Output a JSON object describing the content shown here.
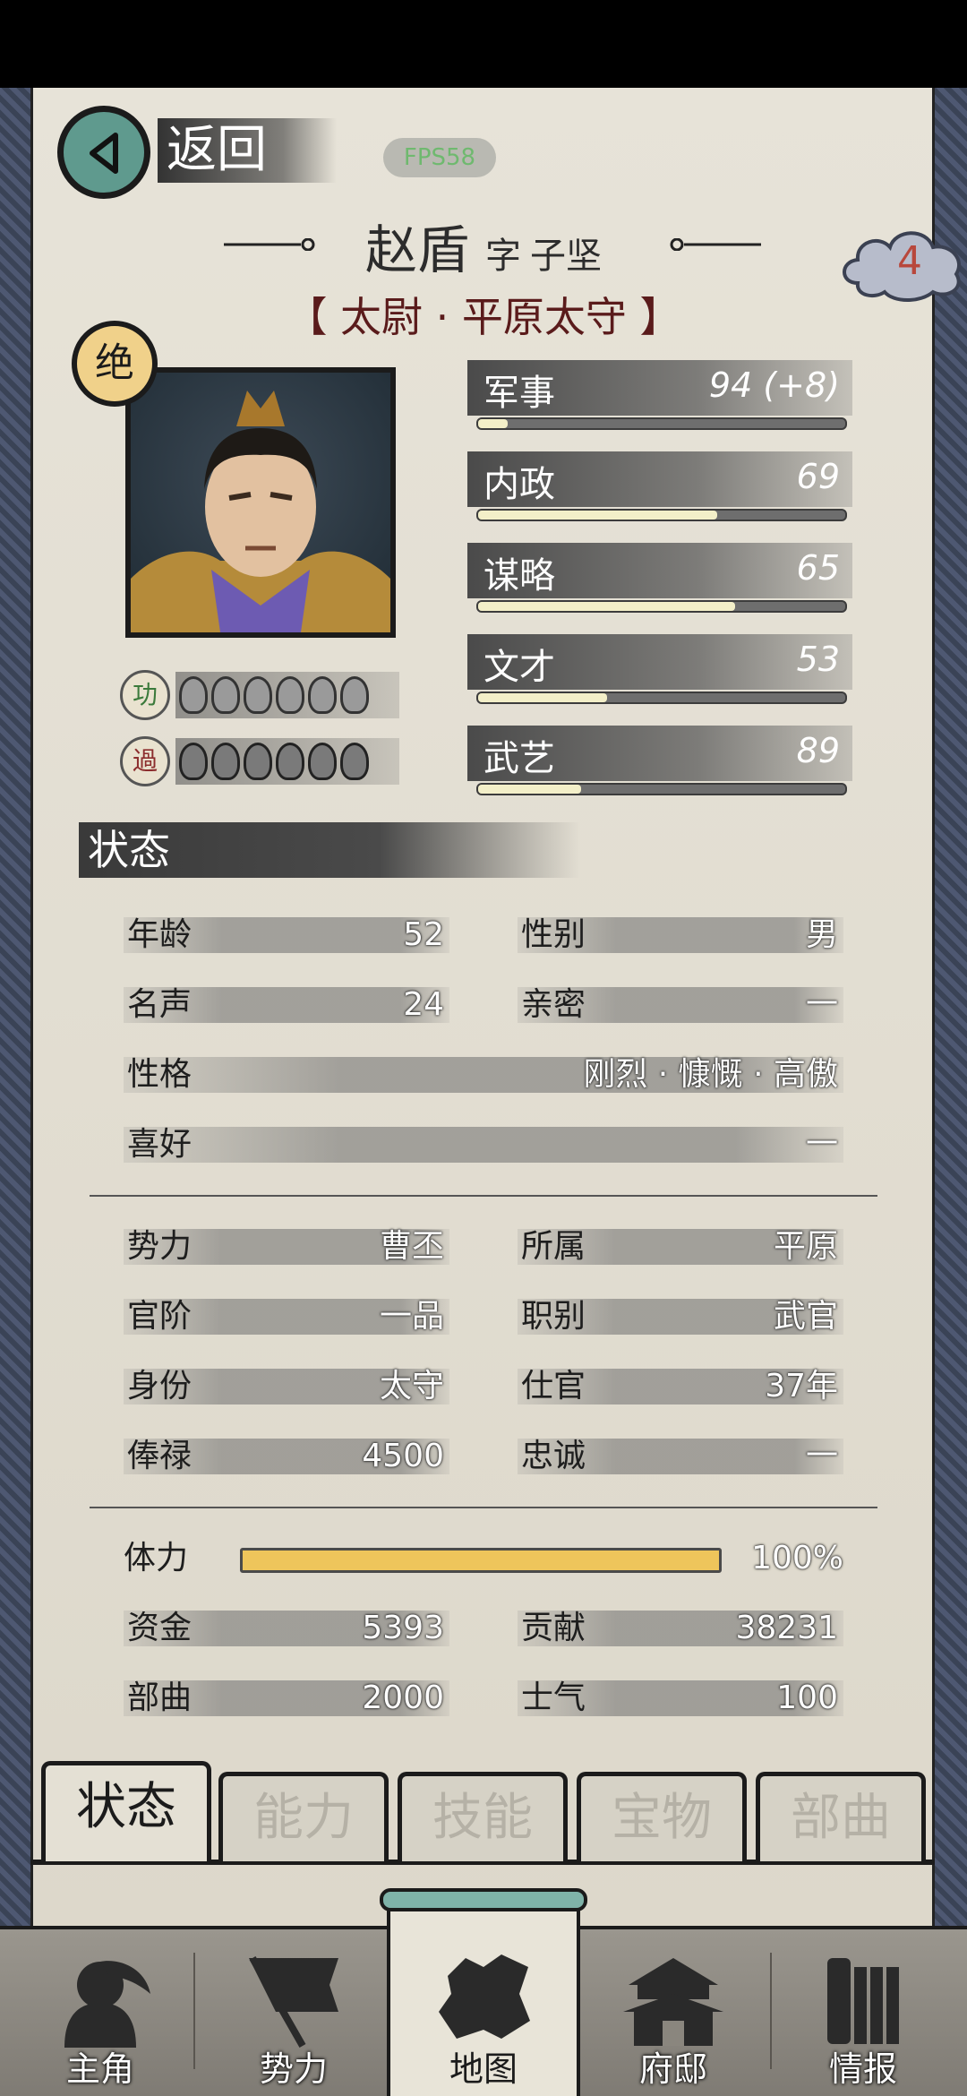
{
  "header": {
    "back_label": "返回",
    "fps": "FPS58"
  },
  "character": {
    "name": "赵盾",
    "courtesy_prefix": "字",
    "courtesy_name": "子坚",
    "title": "【 太尉 · 平原太守 】",
    "rank_badge": "绝",
    "cloud_number": "4",
    "merit_icon": "功",
    "fault_icon": "過"
  },
  "stats": [
    {
      "name": "军事",
      "value": "94  (+8)",
      "fill": 0.08
    },
    {
      "name": "内政",
      "value": "69",
      "fill": 0.65
    },
    {
      "name": "谋略",
      "value": "65",
      "fill": 0.7
    },
    {
      "name": "文才",
      "value": "53",
      "fill": 0.35
    },
    {
      "name": "武艺",
      "value": "89",
      "fill": 0.28
    }
  ],
  "status_section": {
    "title": "状态",
    "age_label": "年龄",
    "age": "52",
    "gender_label": "性别",
    "gender": "男",
    "fame_label": "名声",
    "fame": "24",
    "intimacy_label": "亲密",
    "intimacy": "一",
    "personality_label": "性格",
    "personality": "刚烈 · 慷慨 · 高傲",
    "hobby_label": "喜好",
    "hobby": "一"
  },
  "affiliation": {
    "faction_label": "势力",
    "faction": "曹丕",
    "belong_label": "所属",
    "belong": "平原",
    "rank_label": "官阶",
    "rank": "一品",
    "post_label": "职别",
    "post": "武官",
    "identity_label": "身份",
    "identity": "太守",
    "service_label": "仕官",
    "service": "37年",
    "salary_label": "俸禄",
    "salary": "4500",
    "loyalty_label": "忠诚",
    "loyalty": "一"
  },
  "resources": {
    "stamina_label": "体力",
    "stamina": "100%",
    "stamina_fill": 1.0,
    "funds_label": "资金",
    "funds": "5393",
    "contribution_label": "贡献",
    "contribution": "38231",
    "troops_label": "部曲",
    "troops": "2000",
    "morale_label": "士气",
    "morale": "100"
  },
  "tabs": [
    "状态",
    "能力",
    "技能",
    "宝物",
    "部曲"
  ],
  "nav": [
    "主角",
    "势力",
    "地图",
    "府邸",
    "情报"
  ],
  "colors": {
    "paper": "#e7e3d8",
    "accent_teal": "#5f9a8e",
    "stamina_gold": "#eec55b",
    "title_red": "#5a1b1b"
  }
}
